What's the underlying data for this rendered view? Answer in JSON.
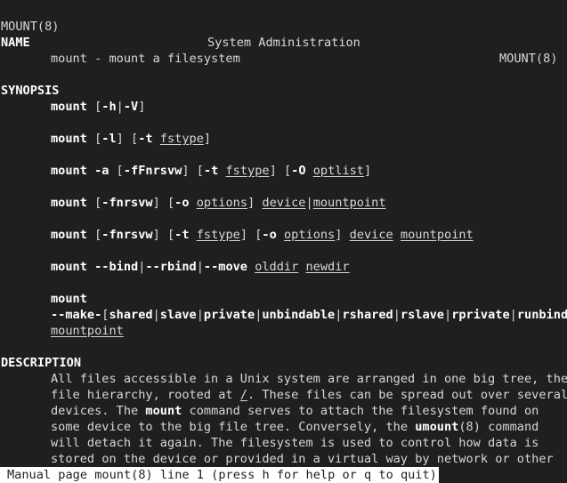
{
  "header": {
    "left": "MOUNT(8)",
    "center": "System Administration",
    "right": "MOUNT(8)"
  },
  "name_section": {
    "heading": "NAME",
    "text": "mount - mount a filesystem"
  },
  "synopsis": {
    "heading": "SYNOPSIS",
    "l1": {
      "cmd": "mount",
      "a": " [",
      "b": "-h",
      "c": "|",
      "d": "-V",
      "e": "]"
    },
    "l2": {
      "cmd": "mount",
      "a": " [",
      "b": "-l",
      "c": "] [",
      "d": "-t",
      "e": " ",
      "f": "fstype",
      "g": "]"
    },
    "l3": {
      "cmd": "mount",
      "a": " ",
      "b": "-a",
      "c": " [",
      "d": "-fFnrsvw",
      "e": "] [",
      "f": "-t",
      "g": " ",
      "h": "fstype",
      "i": "] [",
      "j": "-O",
      "k": " ",
      "l": "optlist",
      "m": "]"
    },
    "l4": {
      "cmd": "mount",
      "a": " [",
      "b": "-fnrsvw",
      "c": "] [",
      "d": "-o",
      "e": " ",
      "f": "options",
      "g": "] ",
      "h": "device",
      "i": "|",
      "j": "mountpoint"
    },
    "l5": {
      "cmd": "mount",
      "a": " [",
      "b": "-fnrsvw",
      "c": "] [",
      "d": "-t",
      "e": " ",
      "f": "fstype",
      "g": "] [",
      "h": "-o",
      "i": " ",
      "j": "options",
      "k": "] ",
      "l": "device",
      "m": " ",
      "n": "mountpoint"
    },
    "l6": {
      "cmd": "mount",
      "a": " ",
      "b": "--bind",
      "c": "|",
      "d": "--rbind",
      "e": "|",
      "f": "--move",
      "g": " ",
      "h": "olddir",
      "i": " ",
      "j": "newdir"
    },
    "l7": {
      "cmd": "mount"
    },
    "l8": {
      "a": "--make-",
      "b": "[",
      "c": "shared",
      "d": "|",
      "e": "slave",
      "f": "|",
      "g": "private",
      "h": "|",
      "i": "unbindable",
      "j": "|",
      "k": "rshared",
      "l": "|",
      "m": "rslave",
      "n": "|",
      "o": "rprivate",
      "p": "|",
      "q": "runbindable"
    },
    "l9": {
      "a": "mountpoint"
    }
  },
  "description": {
    "heading": "DESCRIPTION",
    "p1": "All files accessible in a Unix system are arranged in one big tree, the",
    "p2a": "file hierarchy, rooted at ",
    "p2b": "/",
    "p2c": ". These files can be spread out over several",
    "p3a": "devices. The ",
    "p3b": "mount",
    "p3c": " command serves to attach the filesystem found on",
    "p4a": "some device to the big file tree. Conversely, the ",
    "p4b": "umount",
    "p4c": "(8) command",
    "p5": "will detach it again. The filesystem is used to control how data is",
    "p6": "stored on the device or provided in a virtual way by network or other"
  },
  "status_bar": {
    "text": "Manual page mount(8) line 1 (press h for help or q to quit)"
  }
}
